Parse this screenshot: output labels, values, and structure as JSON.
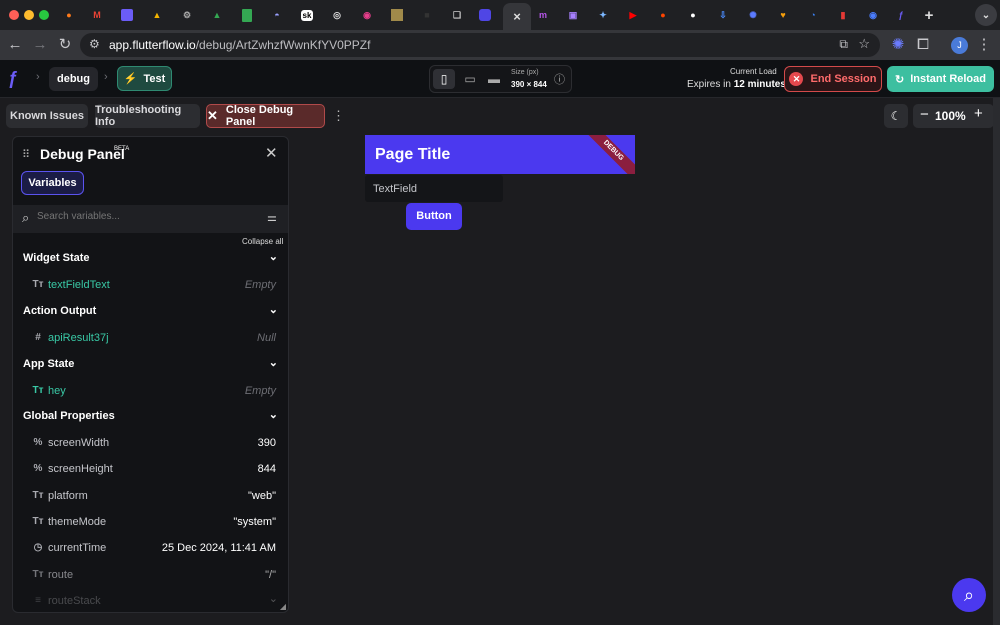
{
  "browser": {
    "url_host": "app.flutterflow.io",
    "url_path": "/debug/ArtZwhzfWwnKfYV0PPZf",
    "profile_initial": "J",
    "tab_badge_sk": "sk"
  },
  "header": {
    "breadcrumb_project": "debug",
    "breadcrumb_mode": "Test",
    "size_label": "Size (px)",
    "size_value": "390 × 844",
    "current_load_label": "Current Load",
    "expires_prefix": "Expires in",
    "expires_value": "12 minutes",
    "end_session_label": "End Session",
    "instant_reload_label": "Instant Reload"
  },
  "toolbar": {
    "known_issues": "Known Issues",
    "troubleshooting": "Troubleshooting Info",
    "close_debug": "Close Debug Panel",
    "zoom": "100%"
  },
  "debug_panel": {
    "title": "Debug Panel",
    "beta": "BETA",
    "tab_variables": "Variables",
    "search_placeholder": "Search variables...",
    "collapse_all": "Collapse all",
    "sections": [
      {
        "title": "Widget State",
        "rows": [
          {
            "name": "textFieldText",
            "value": "Empty"
          }
        ]
      },
      {
        "title": "Action Output",
        "rows": [
          {
            "name": "apiResult37j",
            "value": "Null"
          }
        ]
      },
      {
        "title": "App State",
        "rows": [
          {
            "name": "hey",
            "value": "Empty"
          }
        ]
      },
      {
        "title": "Global Properties",
        "rows": [
          {
            "name": "screenWidth",
            "value": "390"
          },
          {
            "name": "screenHeight",
            "value": "844"
          },
          {
            "name": "platform",
            "value": "\"web\""
          },
          {
            "name": "themeMode",
            "value": "\"system\""
          },
          {
            "name": "currentTime",
            "value": "25 Dec 2024, 11:41 AM"
          },
          {
            "name": "route",
            "value": "\"/\""
          },
          {
            "name": "routeStack",
            "value": ""
          }
        ]
      }
    ]
  },
  "preview": {
    "page_title": "Page Title",
    "debug_ribbon": "DEBUG",
    "textfield_placeholder": "TextField",
    "button_label": "Button"
  },
  "colors": {
    "accent": "#4f46e5",
    "teal": "#39c9a6",
    "end_session_red": "#e5484d",
    "reload_green": "#3dbfa0"
  }
}
